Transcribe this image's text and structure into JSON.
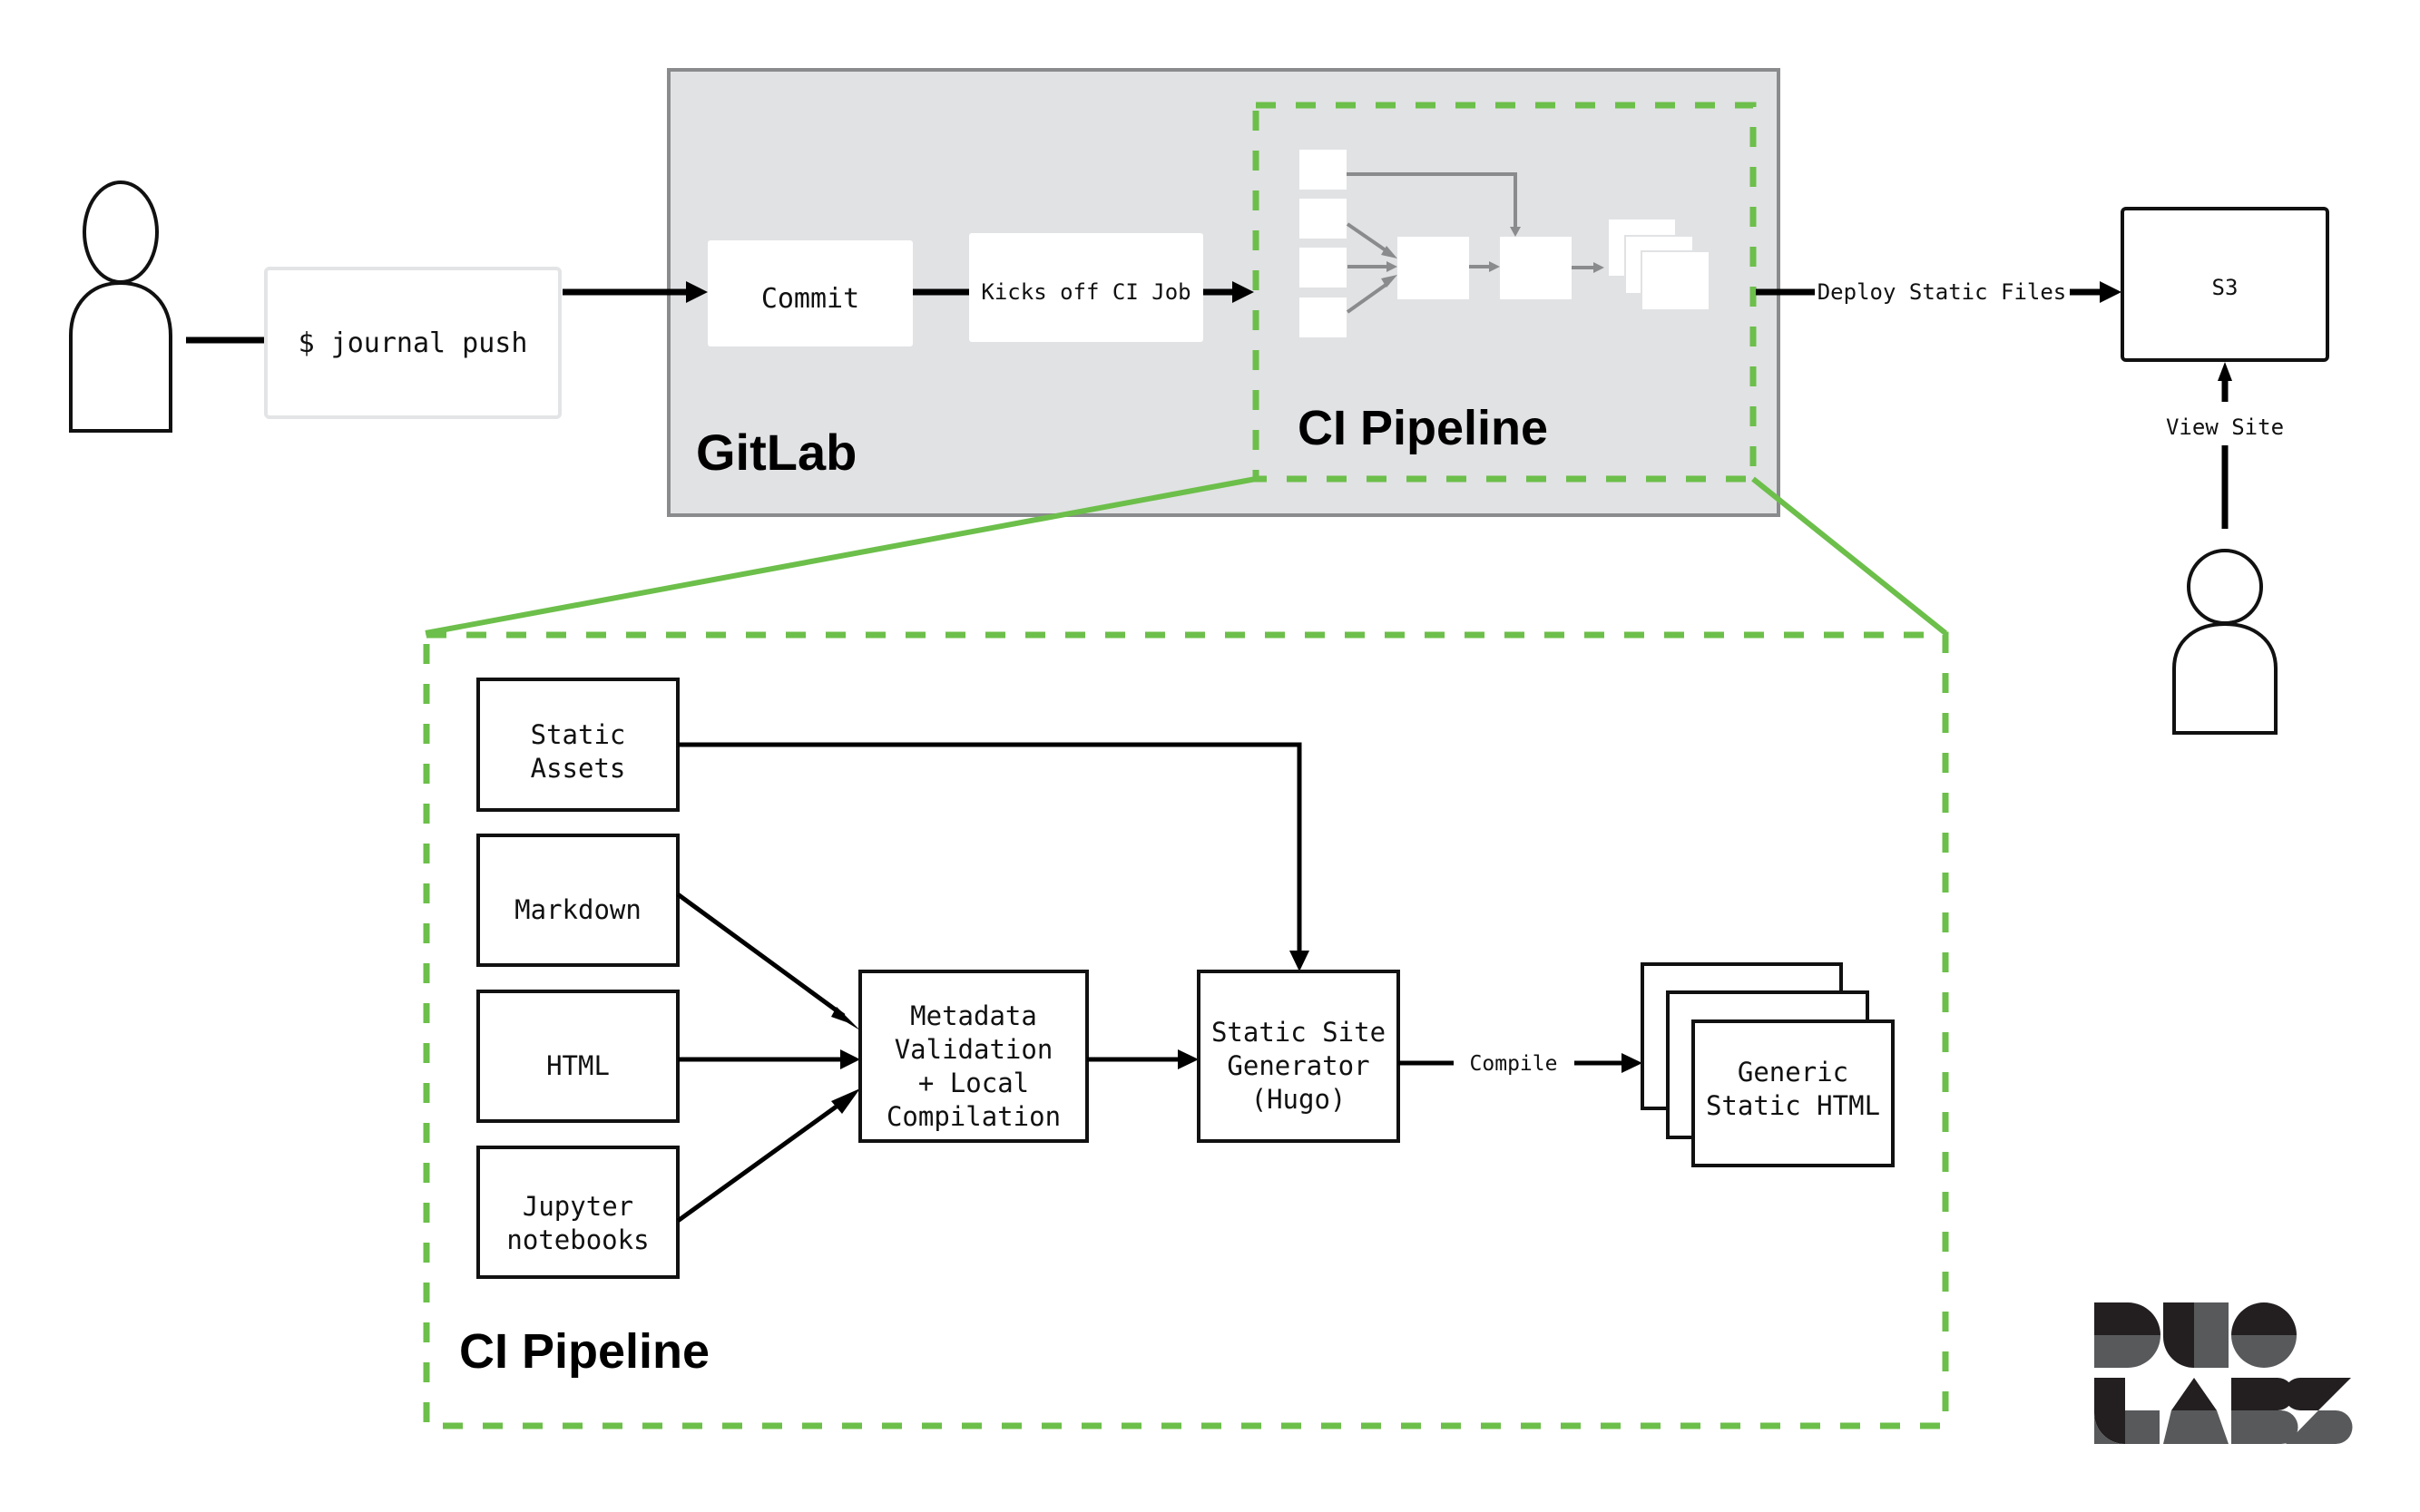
{
  "colors": {
    "accent_green": "#6cbf4a",
    "gitlab_panel": "#e1e2e4",
    "gitlab_border": "#8a8b8d",
    "mini_arrow": "#8a8b8d",
    "logo_dark": "#231f20",
    "logo_mid": "#58595b"
  },
  "top_flow": {
    "author_icon": "person-icon",
    "command_label": "$ journal push",
    "gitlab": {
      "title": "GitLab",
      "commit_label": "Commit",
      "kickoff_label": "Kicks off CI Job",
      "ci_pipeline_title": "CI Pipeline"
    },
    "deploy_label": "Deploy Static Files",
    "s3_label": "S3",
    "view_site_label": "View Site",
    "viewer_icon": "person-icon"
  },
  "ci_pipeline_detail": {
    "title": "CI Pipeline",
    "inputs": [
      {
        "lines": [
          "Static",
          "Assets"
        ]
      },
      {
        "lines": [
          "Markdown"
        ]
      },
      {
        "lines": [
          "HTML"
        ]
      },
      {
        "lines": [
          "Jupyter",
          "notebooks"
        ]
      }
    ],
    "validation": {
      "lines": [
        "Metadata",
        "Validation",
        "+ Local",
        "Compilation"
      ]
    },
    "generator": {
      "lines": [
        "Static Site",
        "Generator",
        "(Hugo)"
      ]
    },
    "compile_label": "Compile",
    "output": {
      "lines": [
        "Generic",
        "Static HTML"
      ]
    }
  },
  "logo": {
    "name": "Duo Labs",
    "rows": [
      "DUO",
      "LABS"
    ]
  }
}
